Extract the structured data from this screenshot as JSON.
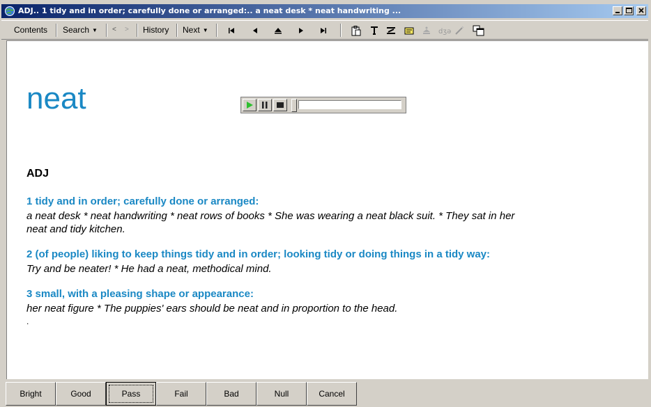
{
  "window": {
    "title": "ADJ.. 1  tidy and in order; carefully done or arranged:.. a neat desk * neat handwriting ..."
  },
  "toolbar": {
    "contents_label": "Contents",
    "search_label": "Search",
    "history_label": "History",
    "next_label": "Next"
  },
  "entry": {
    "headword": "neat",
    "part_of_speech": "ADJ",
    "senses": [
      {
        "definition": "1  tidy and in order; carefully done or arranged:",
        "examples": "a neat desk * neat handwriting * neat rows of books * She was wearing a neat black suit. * They sat in her neat and tidy kitchen."
      },
      {
        "definition": "2  (of people) liking to keep things tidy and in order; looking tidy or doing things in a tidy way:",
        "examples": "Try and be neater! * He had a neat, methodical mind."
      },
      {
        "definition": "3  small, with a pleasing shape or appearance:",
        "examples": "her neat figure * The puppies' ears should be neat and in proportion to the head."
      }
    ],
    "trailing": "."
  },
  "rating_buttons": [
    "Bright",
    "Good",
    "Pass",
    "Fail",
    "Bad",
    "Null",
    "Cancel"
  ],
  "colors": {
    "headword": "#1a88c4",
    "title_bar_start": "#0a246a",
    "title_bar_end": "#a6caf0"
  }
}
